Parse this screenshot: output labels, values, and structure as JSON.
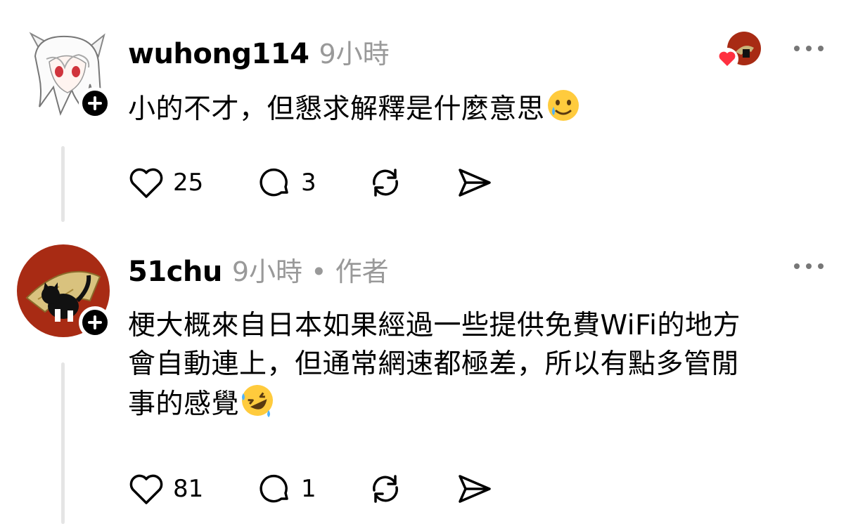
{
  "posts": [
    {
      "username": "wuhong114",
      "meta": "9小時",
      "text": "小的不才，但懇求解釋是什麼意思",
      "emoji": "slightly-smiling-face-with-tear",
      "liked_by_author": true,
      "likes": "25",
      "replies": "3"
    },
    {
      "username": "51chu",
      "meta": "9小時 • 作者",
      "text_lines": [
        "梗大概來自日本如果經過一些提供免費WiFi的地方",
        "會自動連上，但通常網速都極差，所以有點多管閒",
        "事的感覺"
      ],
      "emoji": "rolling-on-the-floor-laughing",
      "likes": "81",
      "replies": "1"
    }
  ],
  "colors": {
    "meta_grey": "#999999",
    "thread_line": "#e5e5e5",
    "heart_red": "#ff3040",
    "avatar_red": "#a82b14"
  }
}
